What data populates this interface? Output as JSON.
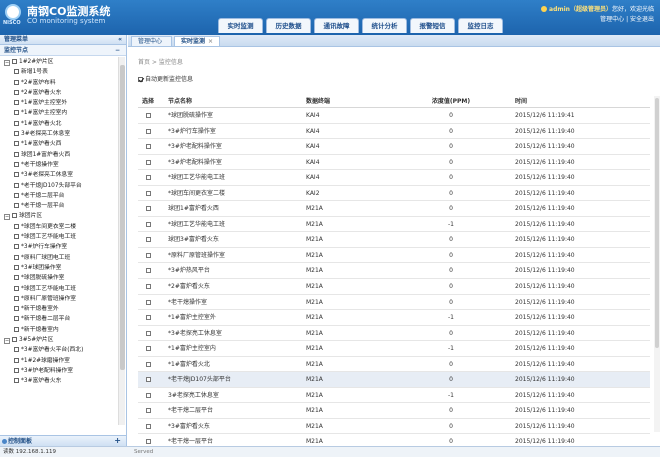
{
  "app": {
    "title": "南钢CO监测系统",
    "subtitle": "CO monitoring system",
    "logo_text": "NISCO"
  },
  "user": {
    "name": "admin",
    "role": "（超级管理员）",
    "greeting": "您好，欢迎光临",
    "links": "管理中心 | 安全退出"
  },
  "nav": [
    "实时监测",
    "历史数据",
    "通讯故障",
    "统计分析",
    "报警短信",
    "监控日志"
  ],
  "sidebar": {
    "title": "管理菜单",
    "collapse": "«",
    "section": "监控节点",
    "section_toggle": "−",
    "control": "控制面板",
    "plus": "+",
    "tree": [
      {
        "t": "1#2#炉片区",
        "g": 1,
        "tg": "−"
      },
      {
        "t": "新增1号表",
        "g": 0
      },
      {
        "t": "*2#富炉布料",
        "g": 0
      },
      {
        "t": "*2#富炉看火东",
        "g": 0
      },
      {
        "t": "*1#富炉主控室外",
        "g": 0
      },
      {
        "t": "*1#富炉主控室内",
        "g": 0
      },
      {
        "t": "*1#富炉看火北",
        "g": 0
      },
      {
        "t": "3#老探亮工休息室",
        "g": 0
      },
      {
        "t": "*1#富炉看火西",
        "g": 0
      },
      {
        "t": "球团1#富炉看火西",
        "g": 0
      },
      {
        "t": "*老干熄操作室",
        "g": 0
      },
      {
        "t": "*3#老探亮工休息室",
        "g": 0
      },
      {
        "t": "*老干熄JD107头部平台",
        "g": 0
      },
      {
        "t": "*老干熄二层平台",
        "g": 0
      },
      {
        "t": "*老干熄一层平台",
        "g": 0
      },
      {
        "t": "球团片区",
        "g": 1,
        "tg": "−"
      },
      {
        "t": "*球团车间更衣室二楼",
        "g": 0
      },
      {
        "t": "*球团工艺华能电工班",
        "g": 0
      },
      {
        "t": "*3#炉行车操作室",
        "g": 0
      },
      {
        "t": "*原料厂球团电工班",
        "g": 0
      },
      {
        "t": "*3#球团操作室",
        "g": 0
      },
      {
        "t": "*球团脱硫操作室",
        "g": 0
      },
      {
        "t": "*球团工艺华能电工班",
        "g": 0
      },
      {
        "t": "*原料厂原管班操作室",
        "g": 0
      },
      {
        "t": "*新干熄看室外",
        "g": 0
      },
      {
        "t": "*新干熄看二层平台",
        "g": 0
      },
      {
        "t": "*新干熄看室内",
        "g": 0
      },
      {
        "t": "3#5#炉片区",
        "g": 1,
        "tg": "−"
      },
      {
        "t": "*3#富炉看火平台(西北)",
        "g": 0
      },
      {
        "t": "*1#2#球磨操作室",
        "g": 0
      },
      {
        "t": "*3#炉老配料操作室",
        "g": 0
      },
      {
        "t": "*3#富炉看火东",
        "g": 0
      }
    ]
  },
  "tabs": [
    {
      "label": "管理中心",
      "close": ""
    },
    {
      "label": "实时监测",
      "close": "×"
    }
  ],
  "breadcrumb": "首页 > 监控信息",
  "auto_refresh": "自动更新监控信息",
  "grid": {
    "headers": [
      "选择",
      "节点名称",
      "数据终端",
      "浓度值(PPM)",
      "时间"
    ],
    "rows": [
      [
        "*球团脱硫操作室",
        "KAI4",
        "0",
        "2015/12/6 11:19:41"
      ],
      [
        "*3#炉行车操作室",
        "KAI4",
        "0",
        "2015/12/6 11:19:40"
      ],
      [
        "*3#炉老配料操作室",
        "KAI4",
        "0",
        "2015/12/6 11:19:40"
      ],
      [
        "*3#炉老配料操作室",
        "KAI4",
        "0",
        "2015/12/6 11:19:40"
      ],
      [
        "*球团工艺华能电工班",
        "KAI4",
        "0",
        "2015/12/6 11:19:40"
      ],
      [
        "*球团车间更衣室二楼",
        "KAI2",
        "0",
        "2015/12/6 11:19:40"
      ],
      [
        "球团1#富炉看火西",
        "M21A",
        "0",
        "2015/12/6 11:19:40"
      ],
      [
        "*球团工艺华能电工班",
        "M21A",
        "-1",
        "2015/12/6 11:19:40"
      ],
      [
        "球团3#富炉看火东",
        "M21A",
        "0",
        "2015/12/6 11:19:40"
      ],
      [
        "*原料厂原管班操作室",
        "M21A",
        "0",
        "2015/12/6 11:19:40"
      ],
      [
        "*3#炉热风平台",
        "M21A",
        "0",
        "2015/12/6 11:19:40"
      ],
      [
        "*2#富炉看火东",
        "M21A",
        "0",
        "2015/12/6 11:19:40"
      ],
      [
        "*老干熄操作室",
        "M21A",
        "0",
        "2015/12/6 11:19:40"
      ],
      [
        "*1#富炉主控室外",
        "M21A",
        "-1",
        "2015/12/6 11:19:40"
      ],
      [
        "*3#老探亮工休息室",
        "M21A",
        "0",
        "2015/12/6 11:19:40"
      ],
      [
        "*1#富炉主控室内",
        "M21A",
        "-1",
        "2015/12/6 11:19:40"
      ],
      [
        "*1#富炉看火北",
        "M21A",
        "0",
        "2015/12/6 11:19:40"
      ],
      [
        "*老干熄JD107头部平台",
        "M21A",
        "0",
        "2015/12/6 11:19:40"
      ],
      [
        "3#老探亮工休息室",
        "M21A",
        "-1",
        "2015/12/6 11:19:40"
      ],
      [
        "*老干熄二层平台",
        "M21A",
        "0",
        "2015/12/6 11:19:40"
      ],
      [
        "*3#富炉看火东",
        "M21A",
        "0",
        "2015/12/6 11:19:40"
      ],
      [
        "*老干熄一层平台",
        "M21A",
        "0",
        "2015/12/6 11:19:40"
      ]
    ]
  },
  "status": {
    "ip": "读数 192.168.1.119",
    "done": "Served"
  },
  "colors": {
    "header": "#1d64ad",
    "accent": "#ffe27a",
    "selected_row": "#e7edf5"
  }
}
